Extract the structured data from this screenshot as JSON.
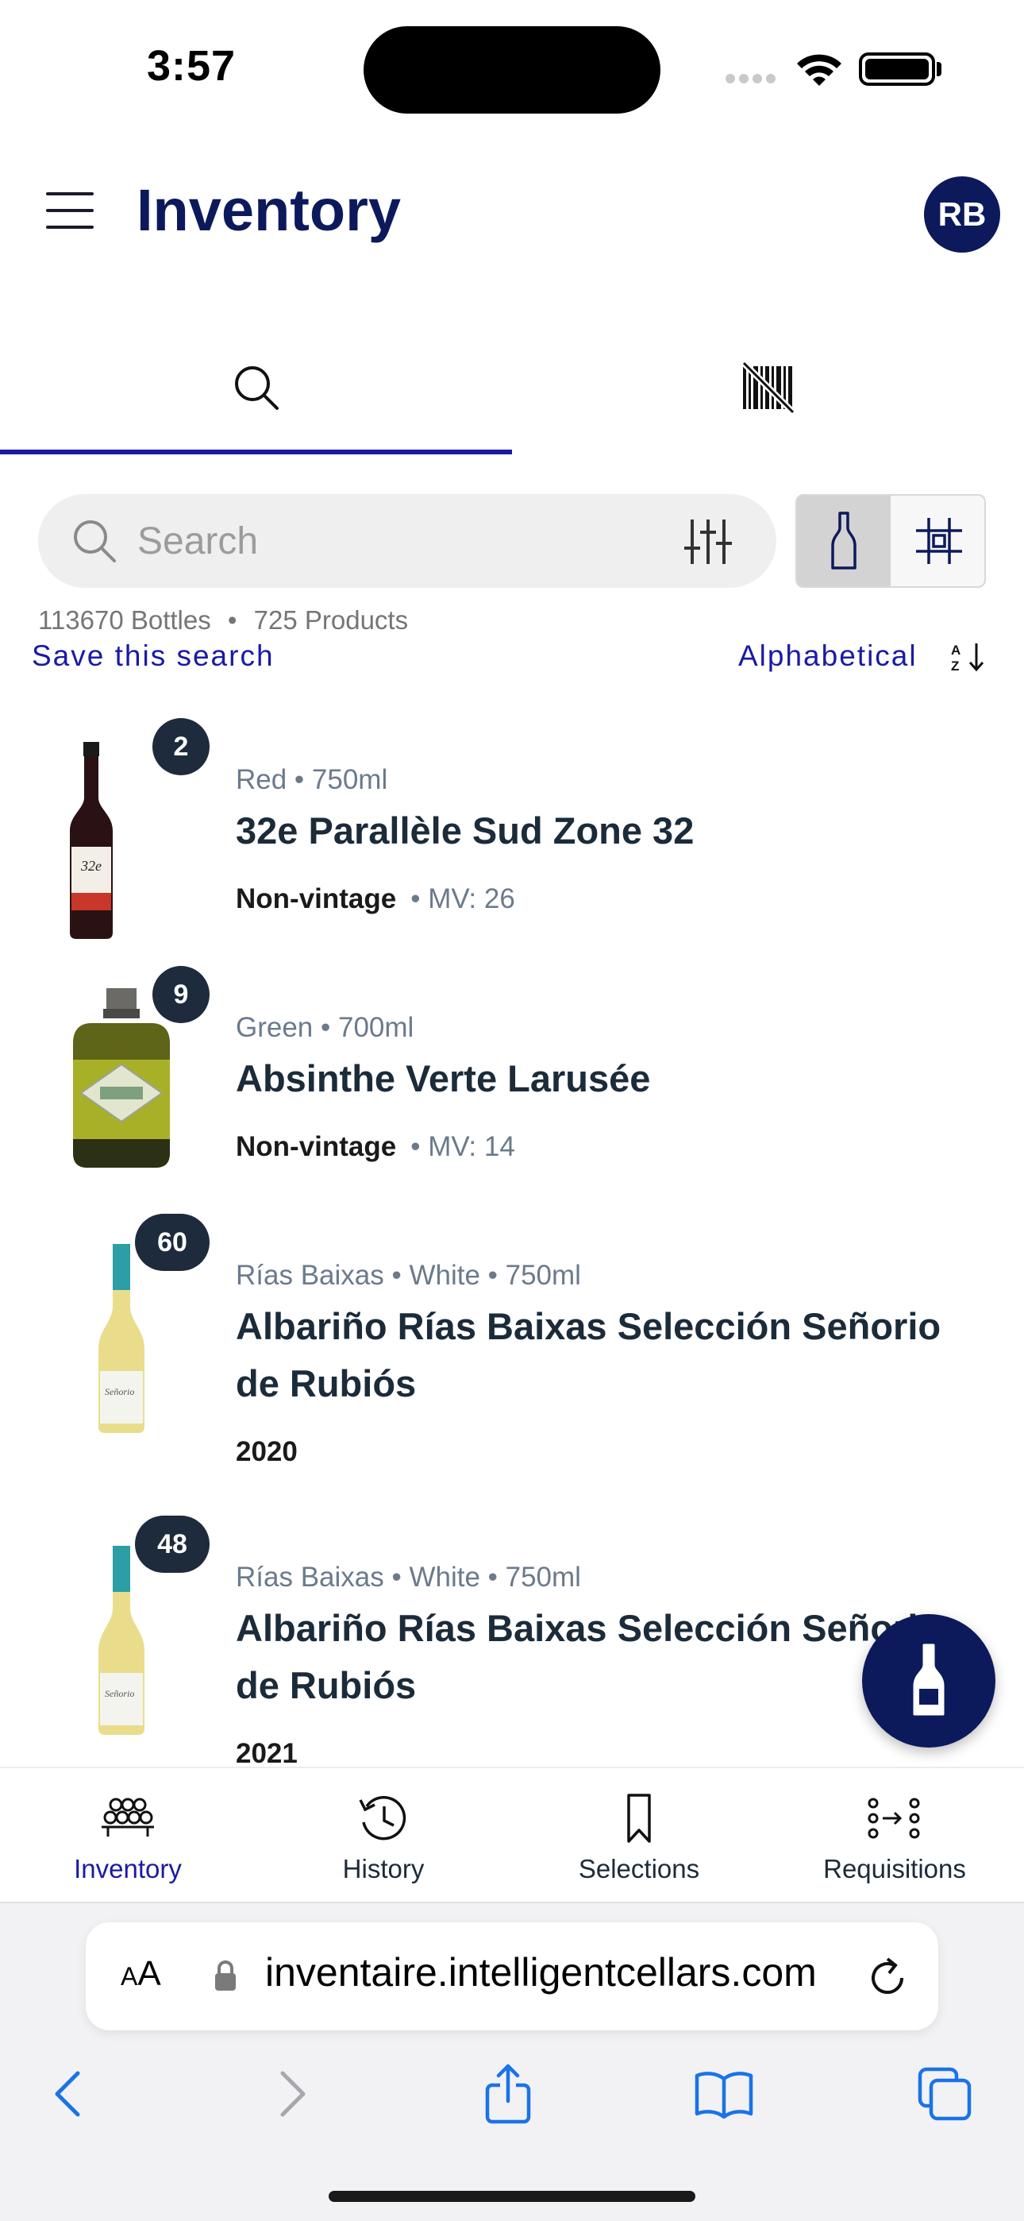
{
  "status_bar": {
    "time": "3:57"
  },
  "header": {
    "title": "Inventory",
    "avatar_initials": "RB"
  },
  "tabs": [
    {
      "name": "search",
      "icon": "search-icon",
      "active": true
    },
    {
      "name": "scan",
      "icon": "barcode-scan-icon",
      "active": false
    }
  ],
  "search": {
    "placeholder": "Search"
  },
  "summary": {
    "bottles": "113670 Bottles",
    "separator": "•",
    "products": "725 Products",
    "save_search": "Save this search",
    "sort": "Alphabetical"
  },
  "items": [
    {
      "count": "2",
      "meta": "Red  •  750ml",
      "name": "32e Parallèle Sud Zone 32",
      "vintage": "Non-vintage",
      "mv": "• MV: 26"
    },
    {
      "count": "9",
      "meta": "Green  •  700ml",
      "name": "Absinthe Verte Larusée",
      "vintage": "Non-vintage",
      "mv": "• MV: 14"
    },
    {
      "count": "60",
      "meta": "Rías Baixas  •  White  •  750ml",
      "name": "Albariño Rías Baixas Selección Señorio de Rubiós",
      "vintage": "2020",
      "mv": ""
    },
    {
      "count": "48",
      "meta": "Rías Baixas  •  White  •  750ml",
      "name": "Albariño Rías Baixas Selección Señorio de Rubiós",
      "vintage": "2021",
      "mv": ""
    }
  ],
  "bottom_nav": [
    {
      "label": "Inventory",
      "icon": "wine-rack-icon",
      "active": true
    },
    {
      "label": "History",
      "icon": "history-icon",
      "active": false
    },
    {
      "label": "Selections",
      "icon": "bookmark-icon",
      "active": false
    },
    {
      "label": "Requisitions",
      "icon": "requisitions-icon",
      "active": false
    }
  ],
  "browser": {
    "text_size": "AA",
    "url": "inventaire.intelligentcellars.com"
  },
  "colors": {
    "brand_navy": "#0c1a5c",
    "accent_blue": "#1a1aa6",
    "badge": "#1e2b3c"
  }
}
